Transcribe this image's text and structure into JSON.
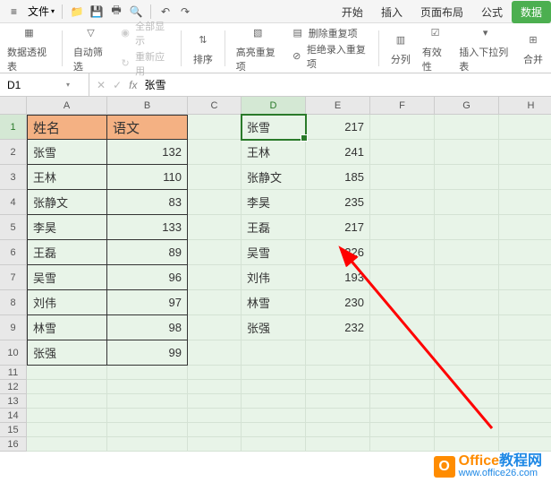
{
  "menubar": {
    "menu_icon": "≡",
    "file": "文件",
    "icons": [
      "folder-icon",
      "save-icon",
      "print-icon",
      "preview-icon",
      "undo-icon",
      "redo-icon"
    ]
  },
  "tabs": {
    "start": "开始",
    "insert": "插入",
    "layout": "页面布局",
    "formula": "公式",
    "data": "数据"
  },
  "ribbon": {
    "pivot": "数据透视表",
    "filter": "自动筛选",
    "show_all": "全部显示",
    "reapply": "重新应用",
    "sort": "排序",
    "highlight": "高亮重复项",
    "remove_dup": "删除重复项",
    "reject_dup": "拒绝录入重复项",
    "split": "分列",
    "validity": "有效性",
    "dropdown": "插入下拉列表",
    "consolidate": "合并"
  },
  "formula_bar": {
    "name_box": "D1",
    "formula": "张雪"
  },
  "columns": [
    {
      "label": "A",
      "width": 90
    },
    {
      "label": "B",
      "width": 90
    },
    {
      "label": "C",
      "width": 60
    },
    {
      "label": "D",
      "width": 72
    },
    {
      "label": "E",
      "width": 72
    },
    {
      "label": "F",
      "width": 72
    },
    {
      "label": "G",
      "width": 72
    },
    {
      "label": "H",
      "width": 72
    }
  ],
  "selected_col": "D",
  "selected_row": 1,
  "row_heights": {
    "main": 28,
    "small": 16
  },
  "table1": {
    "headers": {
      "name": "姓名",
      "score": "语文"
    },
    "rows": [
      {
        "name": "张雪",
        "score": 132
      },
      {
        "name": "王林",
        "score": 110
      },
      {
        "name": "张静文",
        "score": 83
      },
      {
        "name": "李昊",
        "score": 133
      },
      {
        "name": "王磊",
        "score": 89
      },
      {
        "name": "吴雪",
        "score": 96
      },
      {
        "name": "刘伟",
        "score": 97
      },
      {
        "name": "林雪",
        "score": 98
      },
      {
        "name": "张强",
        "score": 99
      }
    ]
  },
  "table2": {
    "rows": [
      {
        "name": "张雪",
        "val": 217
      },
      {
        "name": "王林",
        "val": 241
      },
      {
        "name": "张静文",
        "val": 185
      },
      {
        "name": "李昊",
        "val": 235
      },
      {
        "name": "王磊",
        "val": 217
      },
      {
        "name": "吴雪",
        "val": 226
      },
      {
        "name": "刘伟",
        "val": 193
      },
      {
        "name": "林雪",
        "val": 230
      },
      {
        "name": "张强",
        "val": 232
      }
    ]
  },
  "watermark": {
    "title_part1": "Office",
    "title_part2": "教程网",
    "url": "www.office26.com"
  }
}
